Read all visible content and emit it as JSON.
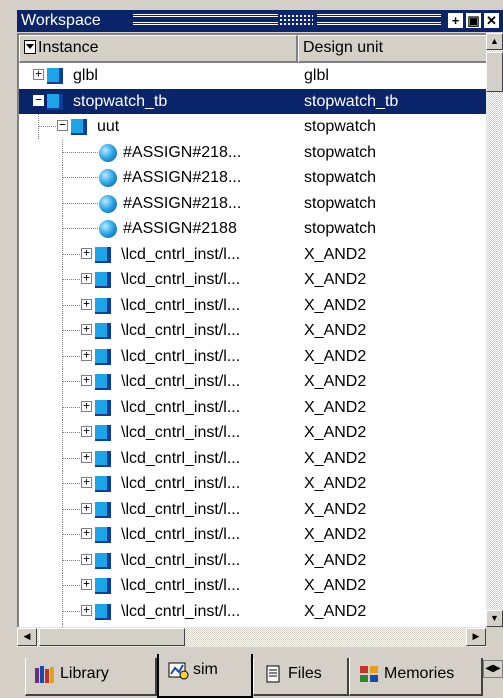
{
  "window": {
    "title": "Workspace",
    "buttons": [
      "+",
      "▣",
      "✕"
    ]
  },
  "tree": {
    "columns": {
      "instance": "Instance",
      "design_unit": "Design unit"
    },
    "rows": [
      {
        "instance": "glbl",
        "unit": "glbl",
        "depth": 0,
        "icon": "block",
        "expander": "+"
      },
      {
        "instance": "stopwatch_tb",
        "unit": "stopwatch_tb",
        "depth": 0,
        "icon": "block",
        "expander": "−",
        "selected": true
      },
      {
        "instance": "uut",
        "unit": "stopwatch",
        "depth": 1,
        "icon": "block",
        "expander": "−"
      },
      {
        "instance": "#ASSIGN#218...",
        "unit": "stopwatch",
        "depth": 2,
        "icon": "ball"
      },
      {
        "instance": "#ASSIGN#218...",
        "unit": "stopwatch",
        "depth": 2,
        "icon": "ball"
      },
      {
        "instance": "#ASSIGN#218...",
        "unit": "stopwatch",
        "depth": 2,
        "icon": "ball"
      },
      {
        "instance": "#ASSIGN#2188",
        "unit": "stopwatch",
        "depth": 2,
        "icon": "ball"
      },
      {
        "instance": "\\lcd_cntrl_inst/l...",
        "unit": "X_AND2",
        "depth": 2,
        "icon": "block",
        "expander": "+"
      },
      {
        "instance": "\\lcd_cntrl_inst/l...",
        "unit": "X_AND2",
        "depth": 2,
        "icon": "block",
        "expander": "+"
      },
      {
        "instance": "\\lcd_cntrl_inst/l...",
        "unit": "X_AND2",
        "depth": 2,
        "icon": "block",
        "expander": "+"
      },
      {
        "instance": "\\lcd_cntrl_inst/l...",
        "unit": "X_AND2",
        "depth": 2,
        "icon": "block",
        "expander": "+"
      },
      {
        "instance": "\\lcd_cntrl_inst/l...",
        "unit": "X_AND2",
        "depth": 2,
        "icon": "block",
        "expander": "+"
      },
      {
        "instance": "\\lcd_cntrl_inst/l...",
        "unit": "X_AND2",
        "depth": 2,
        "icon": "block",
        "expander": "+"
      },
      {
        "instance": "\\lcd_cntrl_inst/l...",
        "unit": "X_AND2",
        "depth": 2,
        "icon": "block",
        "expander": "+"
      },
      {
        "instance": "\\lcd_cntrl_inst/l...",
        "unit": "X_AND2",
        "depth": 2,
        "icon": "block",
        "expander": "+"
      },
      {
        "instance": "\\lcd_cntrl_inst/l...",
        "unit": "X_AND2",
        "depth": 2,
        "icon": "block",
        "expander": "+"
      },
      {
        "instance": "\\lcd_cntrl_inst/l...",
        "unit": "X_AND2",
        "depth": 2,
        "icon": "block",
        "expander": "+"
      },
      {
        "instance": "\\lcd_cntrl_inst/l...",
        "unit": "X_AND2",
        "depth": 2,
        "icon": "block",
        "expander": "+"
      },
      {
        "instance": "\\lcd_cntrl_inst/l...",
        "unit": "X_AND2",
        "depth": 2,
        "icon": "block",
        "expander": "+"
      },
      {
        "instance": "\\lcd_cntrl_inst/l...",
        "unit": "X_AND2",
        "depth": 2,
        "icon": "block",
        "expander": "+"
      },
      {
        "instance": "\\lcd_cntrl_inst/l...",
        "unit": "X_AND2",
        "depth": 2,
        "icon": "block",
        "expander": "+"
      },
      {
        "instance": "\\lcd_cntrl_inst/l...",
        "unit": "X_AND2",
        "depth": 2,
        "icon": "block",
        "expander": "+"
      },
      {
        "instance": "\\lcd_cntrl_inst/l...",
        "unit": "X_AND2",
        "depth": 2,
        "icon": "block",
        "expander": "+"
      }
    ]
  },
  "tabs": [
    {
      "label": "Library",
      "icon": "library-icon"
    },
    {
      "label": "sim",
      "icon": "sim-icon",
      "active": true
    },
    {
      "label": "Files",
      "icon": "files-icon"
    },
    {
      "label": "Memories",
      "icon": "memories-icon"
    }
  ],
  "colors": {
    "selection": "#0a246a",
    "icon_fill": "#1ba4e8",
    "icon_edge": "#0d3e9a"
  }
}
